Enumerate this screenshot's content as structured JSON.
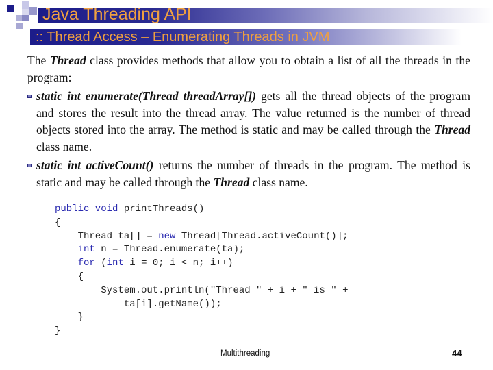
{
  "slide": {
    "title": "Java Threading API",
    "subtitle": ":: Thread Access – Enumerating Threads in JVM",
    "accent_color": "#f0a040",
    "bar_color": "#1c1c8a"
  },
  "body": {
    "intro": {
      "pre": "The ",
      "bold": "Thread",
      "post": " class provides methods that allow you to obtain a list of all the threads in the program:"
    },
    "bullets": [
      {
        "icon": "square-bullet-icon",
        "signature": "static int enumerate(Thread threadArray[])",
        "text_a": " gets all the thread objects of the program and stores the result into the thread array. The value returned is the number of thread objects stored into the array. The method is static and may be called through the ",
        "bold": "Thread",
        "text_b": " class name."
      },
      {
        "icon": "square-bullet-icon",
        "signature": "static int activeCount()",
        "text_a": " returns the number of threads in the program. The method is static and may be called through the ",
        "bold": "Thread",
        "text_b": " class name."
      }
    ]
  },
  "code": {
    "lines": [
      [
        {
          "t": "public void",
          "k": true
        },
        {
          "t": " printThreads()"
        }
      ],
      [
        {
          "t": "{"
        }
      ],
      [
        {
          "t": "    Thread ta[] = "
        },
        {
          "t": "new",
          "k": true
        },
        {
          "t": " Thread[Thread.activeCount()];"
        }
      ],
      [
        {
          "t": "    "
        },
        {
          "t": "int",
          "k": true
        },
        {
          "t": " n = Thread.enumerate(ta);"
        }
      ],
      [
        {
          "t": "    "
        },
        {
          "t": "for",
          "k": true
        },
        {
          "t": " ("
        },
        {
          "t": "int",
          "k": true
        },
        {
          "t": " i = 0; i < n; i++)"
        }
      ],
      [
        {
          "t": "    {"
        }
      ],
      [
        {
          "t": "        System.out.println(\"Thread \" + i + \" is \" +"
        }
      ],
      [
        {
          "t": "            ta[i].getName());"
        }
      ],
      [
        {
          "t": "    }"
        }
      ],
      [
        {
          "t": "}"
        }
      ]
    ]
  },
  "footer": {
    "label": "Multithreading",
    "page_number": "44"
  }
}
